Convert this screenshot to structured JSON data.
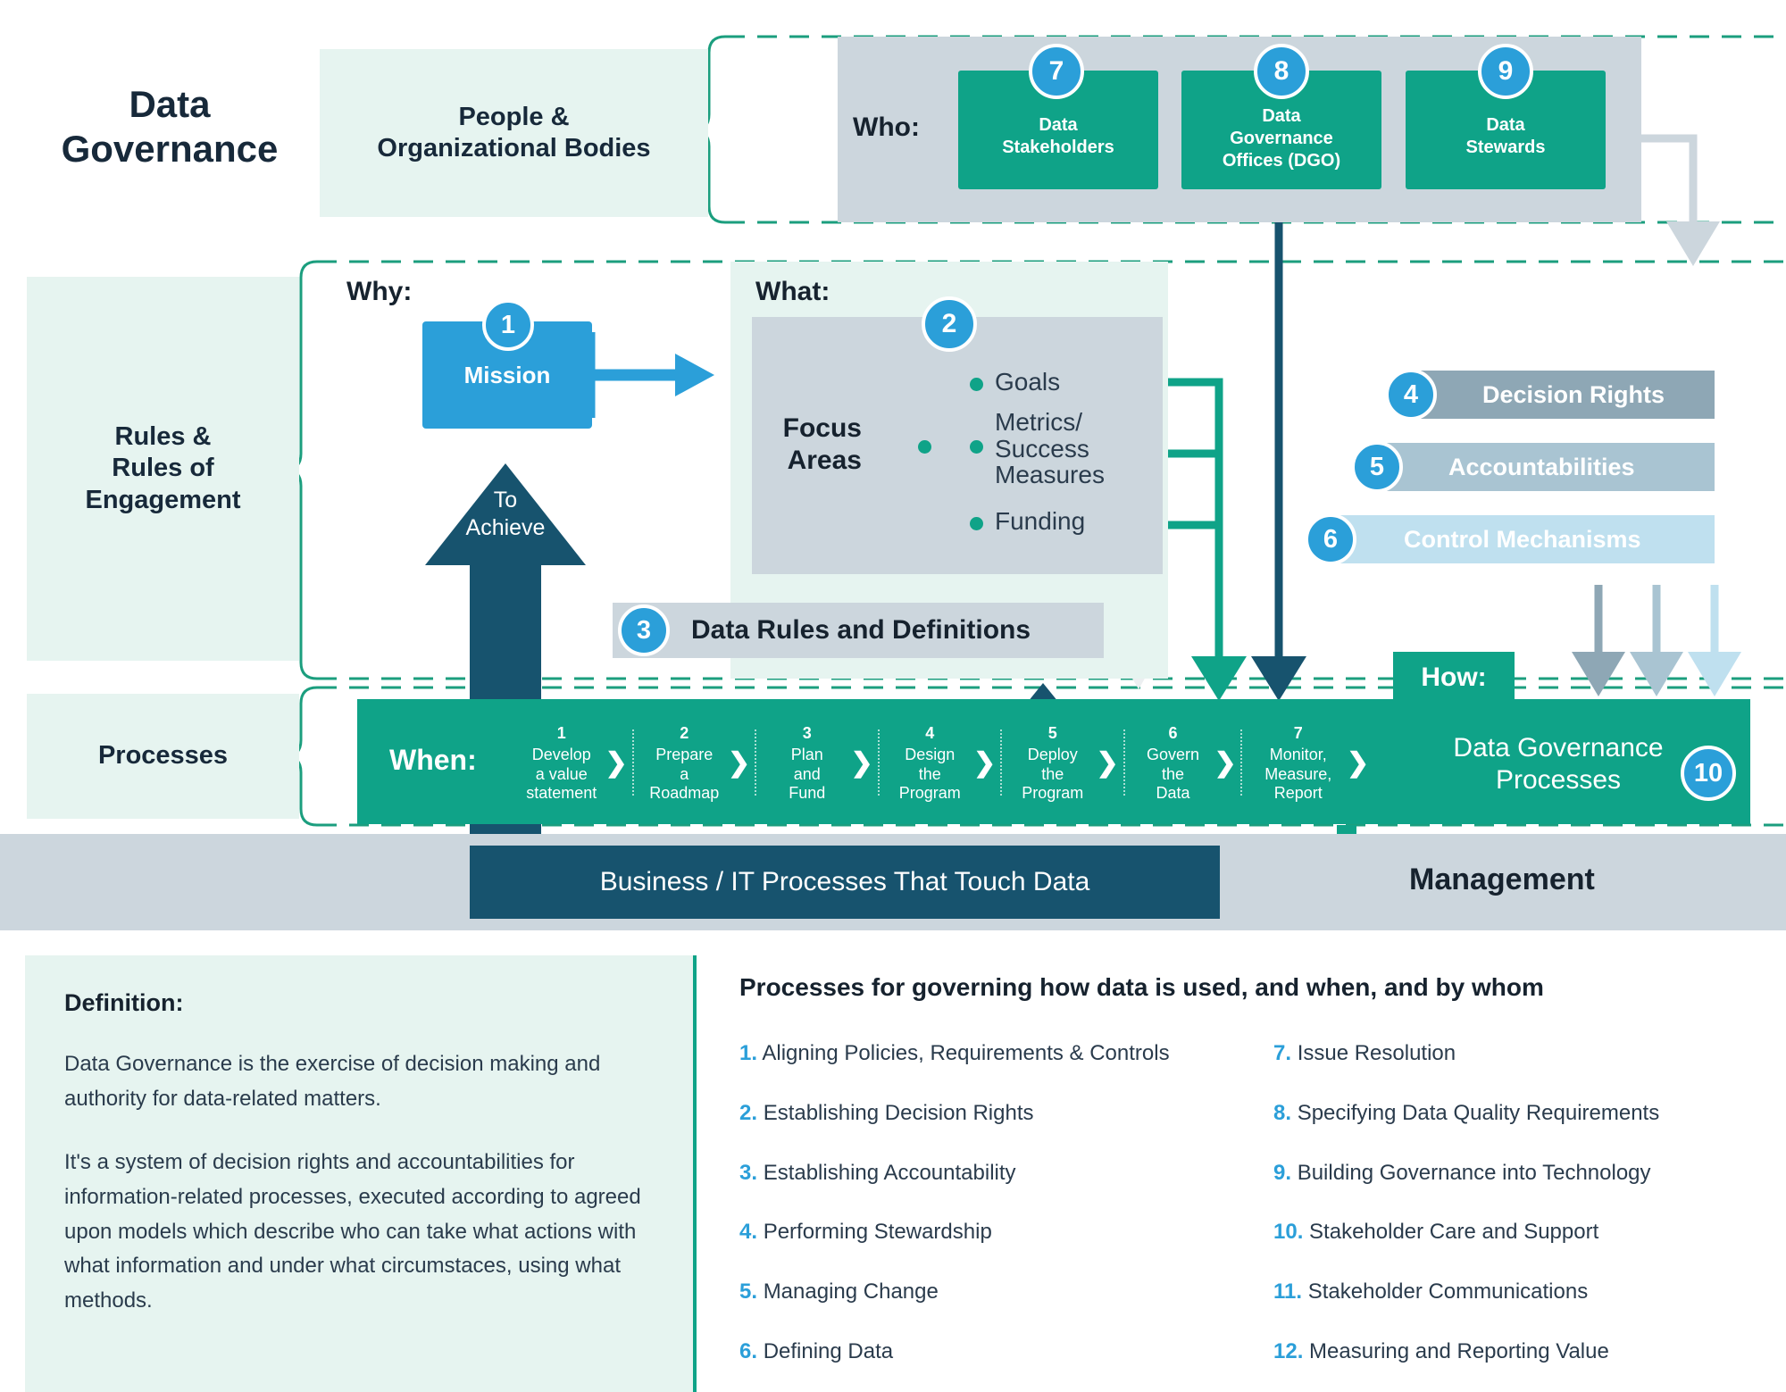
{
  "title": "Data\nGovernance",
  "title_line1": "Data",
  "title_line2": "Governance",
  "colors": {
    "teal": "#0fa388",
    "blue": "#2b9fd9",
    "navy": "#17536e",
    "gray_box": "#ccd6dd",
    "mint": "#e6f4f0"
  },
  "categories": [
    {
      "label": "People &\nOrganizational Bodies",
      "line1": "People &",
      "line2": "Organizational Bodies"
    },
    {
      "label": "Rules &\nRules of\nEngagement",
      "line1": "Rules &",
      "line2": "Rules of",
      "line3": "Engagement"
    },
    {
      "label": "Processes"
    }
  ],
  "who": {
    "label": "Who:",
    "boxes": [
      {
        "num": "7",
        "line1": "Data",
        "line2": "Stakeholders",
        "line3": ""
      },
      {
        "num": "8",
        "line1": "Data",
        "line2": "Governance",
        "line3": "Offices (DGO)"
      },
      {
        "num": "9",
        "line1": "Data",
        "line2": "Stewards",
        "line3": ""
      }
    ]
  },
  "why": {
    "label": "Why:",
    "mission": {
      "num": "1",
      "label": "Mission"
    },
    "to_achieve_line1": "To",
    "to_achieve_line2": "Achieve"
  },
  "what": {
    "label": "What:",
    "badge": "2",
    "focus_line1": "Focus",
    "focus_line2": "Areas",
    "items": [
      {
        "text": "Goals",
        "lines": [
          "Goals"
        ]
      },
      {
        "text": "Metrics/ Success Measures",
        "lines": [
          "Metrics/",
          "Success",
          "Measures"
        ]
      },
      {
        "text": "Funding",
        "lines": [
          "Funding"
        ]
      }
    ]
  },
  "rights_stack": [
    {
      "num": "4",
      "label": "Decision Rights"
    },
    {
      "num": "5",
      "label": "Accountabilities"
    },
    {
      "num": "6",
      "label": "Control Mechanisms"
    }
  ],
  "data_rules": {
    "num": "3",
    "label": "Data Rules and Definitions"
  },
  "when": {
    "label": "When:",
    "steps": [
      {
        "num": "1",
        "lines": [
          "Develop",
          "a value",
          "statement"
        ]
      },
      {
        "num": "2",
        "lines": [
          "Prepare",
          "a",
          "Roadmap"
        ]
      },
      {
        "num": "3",
        "lines": [
          "Plan",
          "and",
          "Fund"
        ]
      },
      {
        "num": "4",
        "lines": [
          "Design",
          "the",
          "Program"
        ]
      },
      {
        "num": "5",
        "lines": [
          "Deploy",
          "the",
          "Program"
        ]
      },
      {
        "num": "6",
        "lines": [
          "Govern",
          "the",
          "Data"
        ]
      },
      {
        "num": "7",
        "lines": [
          "Monitor,",
          "Measure,",
          "Report"
        ]
      }
    ]
  },
  "how": {
    "label": "How:",
    "badge": "10",
    "line1": "Data Governance",
    "line2": "Processes"
  },
  "management": {
    "label": "Management",
    "business_processes": "Business / IT Processes That Touch Data"
  },
  "definition": {
    "title": "Definition:",
    "paragraph1": "Data Governance is the exercise of decision making and authority for data-related matters.",
    "paragraph2": "It's a system of decision rights and accountabilities for information-related processes, executed according to agreed upon models which describe who can take what actions with what information and under what circumstaces, using what methods."
  },
  "processes_list": {
    "title": "Processes for governing how data is used, and when, and by whom",
    "left": [
      {
        "num": "1.",
        "text": "Aligning Policies, Requirements & Controls"
      },
      {
        "num": "2.",
        "text": "Establishing Decision Rights"
      },
      {
        "num": "3.",
        "text": "Establishing Accountability"
      },
      {
        "num": "4.",
        "text": "Performing Stewardship"
      },
      {
        "num": "5.",
        "text": "Managing Change"
      },
      {
        "num": "6.",
        "text": "Defining Data"
      }
    ],
    "right": [
      {
        "num": "7.",
        "text": "Issue Resolution"
      },
      {
        "num": "8.",
        "text": "Specifying Data Quality Requirements"
      },
      {
        "num": "9.",
        "text": "Building Governance into Technology"
      },
      {
        "num": "10.",
        "text": "Stakeholder Care and Support"
      },
      {
        "num": "11.",
        "text": "Stakeholder Communications"
      },
      {
        "num": "12.",
        "text": "Measuring and Reporting Value"
      }
    ]
  }
}
